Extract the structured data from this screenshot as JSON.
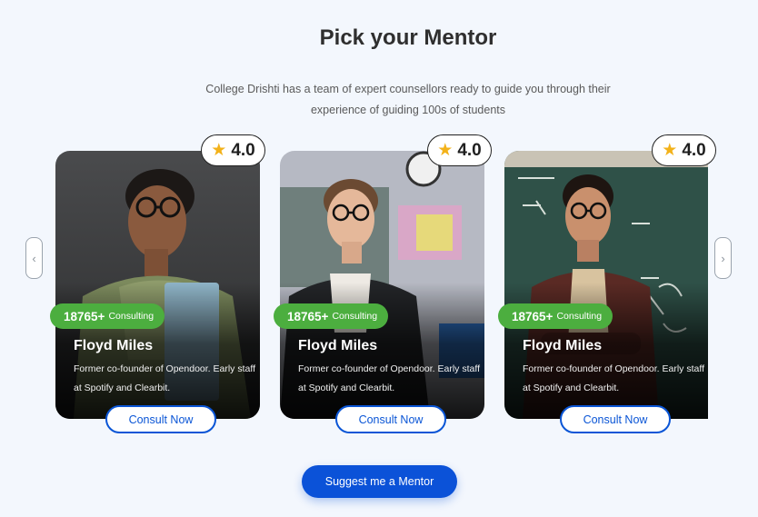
{
  "header": {
    "title": "Pick your Mentor",
    "subtitle": "College Drishti has a team of expert counsellors ready to guide you through their experience of guiding 100s of students"
  },
  "nav": {
    "prev_glyph": "‹",
    "next_glyph": "›"
  },
  "mentors": [
    {
      "rating": "4.0",
      "count": "18765+",
      "count_label": "Consulting",
      "name": "Floyd Miles",
      "description": "Former co-founder of Opendoor. Early staff at Spotify and Clearbit.",
      "button": "Consult Now"
    },
    {
      "rating": "4.0",
      "count": "18765+",
      "count_label": "Consulting",
      "name": "Floyd Miles",
      "description": "Former co-founder of Opendoor. Early staff at Spotify and Clearbit.",
      "button": "Consult Now"
    },
    {
      "rating": "4.0",
      "count": "18765+",
      "count_label": "Consulting",
      "name": "Floyd Miles",
      "description": "Former co-founder of Opendoor. Early staff at Spotify and Clearbit.",
      "button": "Consult Now"
    }
  ],
  "cta": {
    "label": "Suggest me a Mentor"
  },
  "colors": {
    "accent": "#0b52d8",
    "badge": "#4cae3f",
    "star": "#f3b21a",
    "background": "#f3f7fd"
  }
}
